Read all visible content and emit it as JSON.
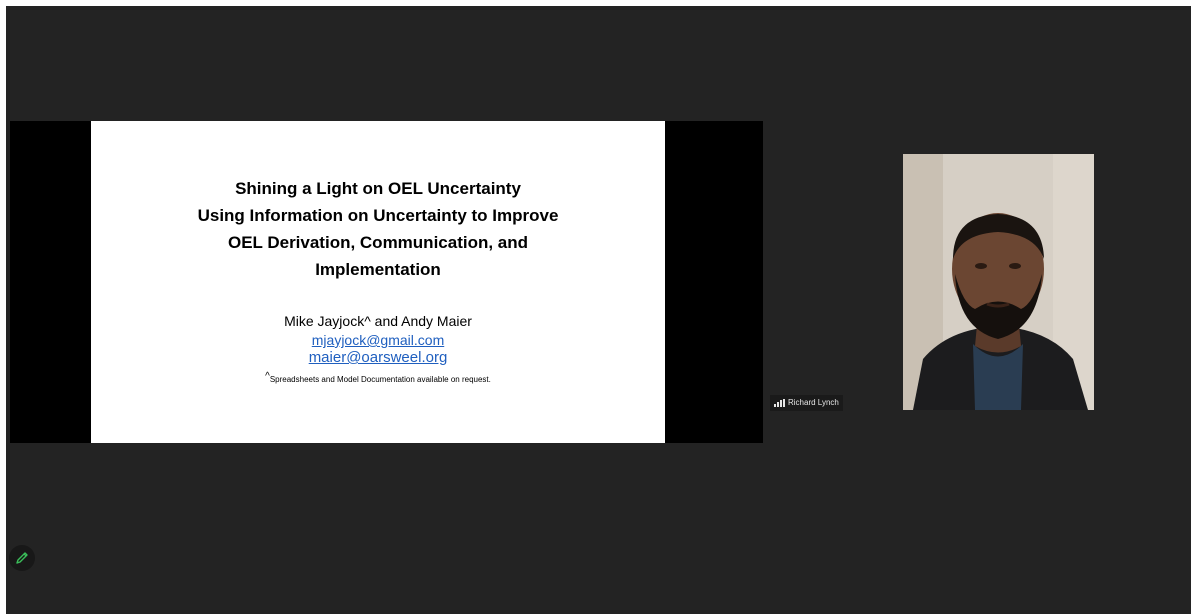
{
  "slide": {
    "title_lines": [
      "Shining a Light on OEL Uncertainty",
      "Using Information on Uncertainty to Improve",
      "OEL Derivation, Communication, and",
      "Implementation"
    ],
    "authors": "Mike Jayjock^ and Andy Maier",
    "emails": [
      "mjayjock@gmail.com",
      "maier@oarsweel.org"
    ],
    "footnote_marker": "^",
    "footnote": "Spreadsheets and Model Documentation available on request."
  },
  "participant": {
    "name": "Richard Lynch",
    "signal_icon": "signal-bars-icon"
  },
  "toolbar": {
    "annotate_icon": "pencil-icon"
  },
  "colors": {
    "stage_background": "#232323",
    "share_background": "#000000",
    "link": "#1f5fbf",
    "annotate_icon": "#3bbf5a"
  }
}
